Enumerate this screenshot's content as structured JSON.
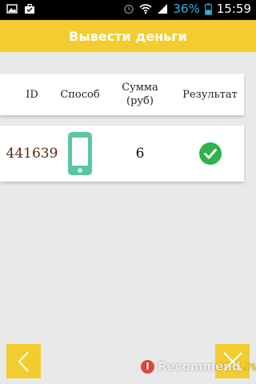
{
  "status_bar": {
    "battery_percent": "36%",
    "time": "15:59",
    "icons": [
      "image-icon",
      "briefcase-icon",
      "alarm-icon",
      "wifi-icon",
      "signal-icon",
      "battery-icon"
    ],
    "battery_color": "#33b5e5"
  },
  "header": {
    "title": "Вывести деньги",
    "color": "#f3cd2f"
  },
  "table": {
    "columns": [
      "ID",
      "Способ",
      "Сумма (руб)",
      "Результат"
    ],
    "column_lines": {
      "amount_line1": "Сумма",
      "amount_line2": "(руб)"
    },
    "rows": [
      {
        "id": "441639",
        "method_icon": "smartphone-icon",
        "amount": "6",
        "result_icon": "check-circle-icon"
      }
    ]
  },
  "bottom_bar": {
    "back_icon": "chevron-left-icon",
    "close_icon": "close-icon"
  },
  "watermark": {
    "badge": "I",
    "text": "Recommend",
    "suffix": ".ru"
  }
}
